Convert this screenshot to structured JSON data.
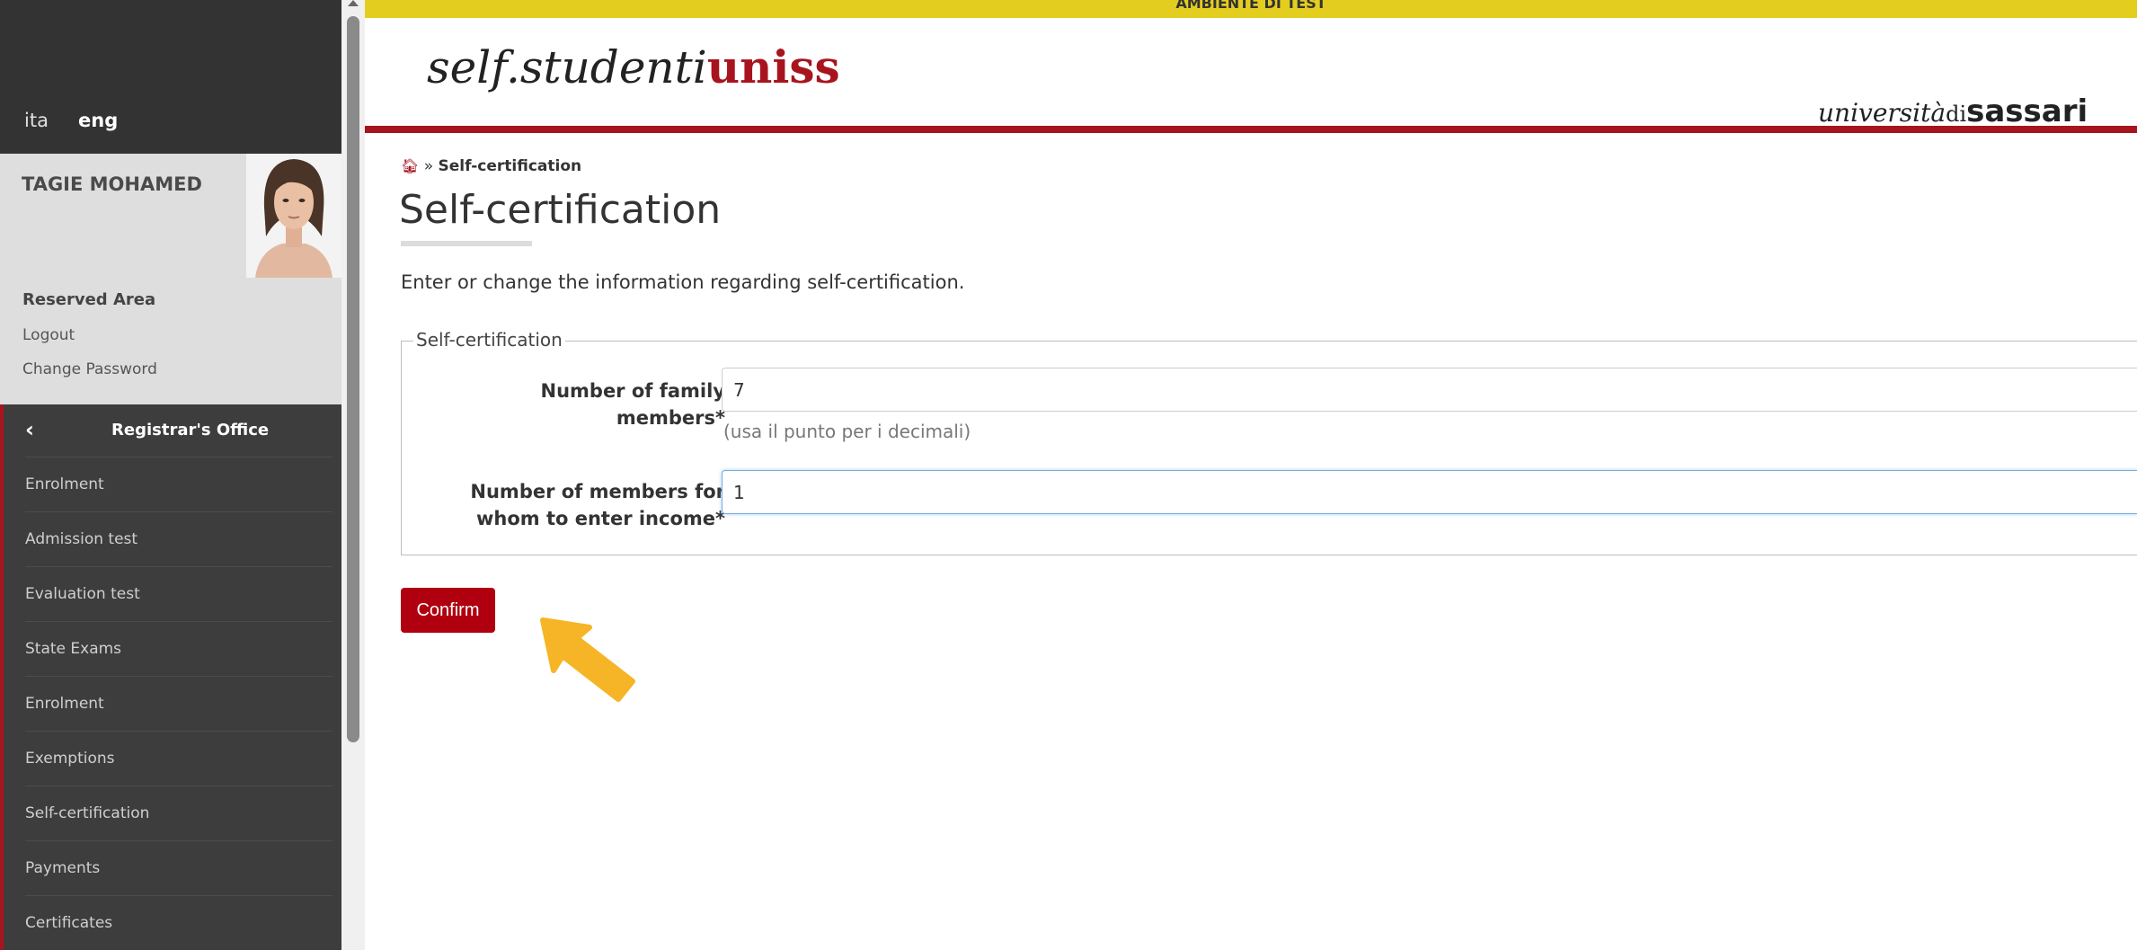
{
  "header": {
    "test_banner": "AMBIENTE DI TEST",
    "brand_prefix": "self.studenti",
    "brand_suffix": "uniss",
    "univ_prefix": "università",
    "univ_di": "di",
    "univ_name": "sassari"
  },
  "sidebar": {
    "languages": [
      "ita",
      "eng"
    ],
    "active_language": "eng",
    "user_name": "TAGIE MOHAMED",
    "reserved_area_title": "Reserved Area",
    "links": [
      "Logout",
      "Change Password"
    ],
    "section_title": "Registrar's Office",
    "items": [
      {
        "label": "Enrolment"
      },
      {
        "label": "Admission test"
      },
      {
        "label": "Evaluation test"
      },
      {
        "label": "State Exams"
      },
      {
        "label": "Enrolment"
      },
      {
        "label": "Exemptions"
      },
      {
        "label": "Self-certification"
      },
      {
        "label": "Payments"
      },
      {
        "label": "Certificates"
      }
    ]
  },
  "main": {
    "breadcrumb_sep": "»",
    "breadcrumb_current": "Self-certification",
    "title": "Self-certification",
    "intro": "Enter or change the information regarding self-certification.",
    "fieldset_legend": "Self-certification",
    "fields": [
      {
        "label_line1": "Number of family",
        "label_line2": "members*",
        "value": "7",
        "help": "(usa il punto per i decimali)"
      },
      {
        "label_line1": "Number of members for",
        "label_line2": "whom to enter income*",
        "value": "1"
      }
    ],
    "confirm_label": "Confirm"
  },
  "colors": {
    "accent": "#a8141e",
    "button": "#b0000f",
    "banner": "#e3cd1f",
    "sidebar": "#3d3d3d",
    "pointer": "#f5b526"
  },
  "icons": [
    "home-icon",
    "chevron-left-icon",
    "pointer-arrow-icon"
  ]
}
